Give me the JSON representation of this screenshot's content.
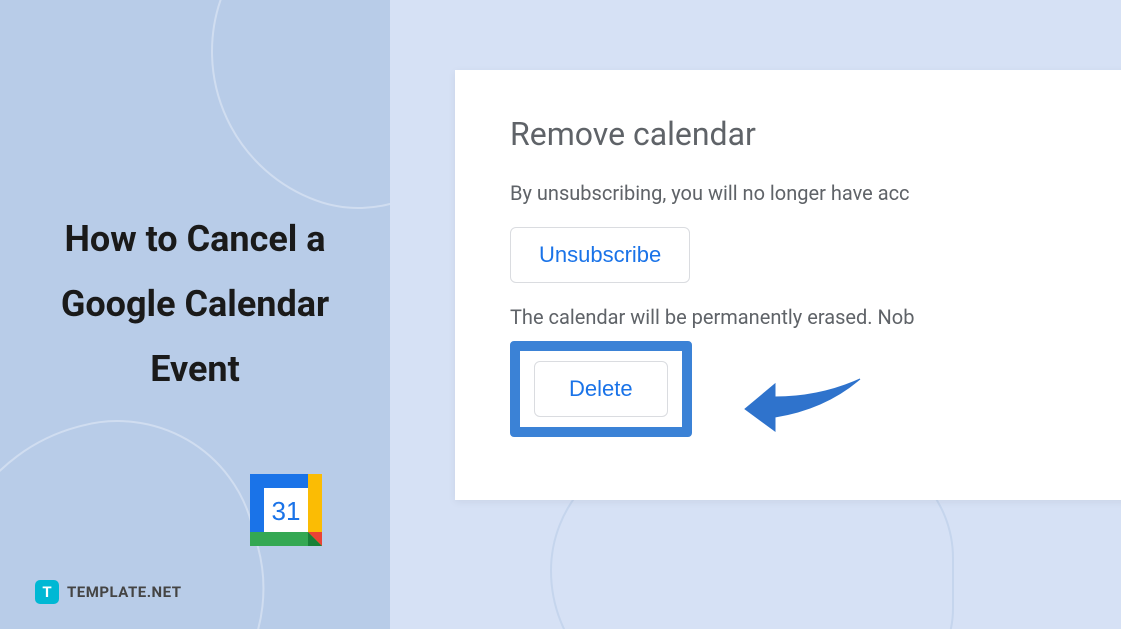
{
  "article": {
    "title": "How to Cancel a Google Calendar Event"
  },
  "brand": {
    "icon_letter": "T",
    "name": "TEMPLATE.NET"
  },
  "calendar_icon": {
    "day_number": "31"
  },
  "dialog": {
    "heading": "Remove calendar",
    "unsubscribe_desc": "By unsubscribing, you will no longer have acc",
    "unsubscribe_label": "Unsubscribe",
    "delete_desc": "The calendar will be permanently erased. Nob",
    "delete_label": "Delete"
  },
  "colors": {
    "google_blue": "#1a73e8",
    "highlight_blue": "#3b82d6",
    "text_gray": "#5f6368"
  }
}
